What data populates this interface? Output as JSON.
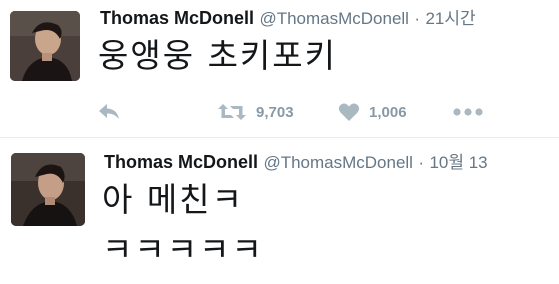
{
  "tweets": [
    {
      "name": "Thomas McDonell",
      "handle": "@ThomasMcDonell",
      "separator": "·",
      "time": "21시간",
      "text": "웅앵웅 초키포키",
      "retweets": "9,703",
      "likes": "1,006"
    },
    {
      "name": "Thomas McDonell",
      "handle": "@ThomasMcDonell",
      "separator": "·",
      "time": "10월 13",
      "text_line1": "아 메친ㅋ",
      "text_line2": "ㅋㅋㅋㅋㅋ"
    }
  ],
  "icons": {
    "reply": "reply-icon",
    "retweet": "retweet-icon",
    "like": "heart-icon",
    "more": "more-icon"
  },
  "colors": {
    "name": "#14171a",
    "meta": "#657786",
    "action": "#aab8c2"
  }
}
